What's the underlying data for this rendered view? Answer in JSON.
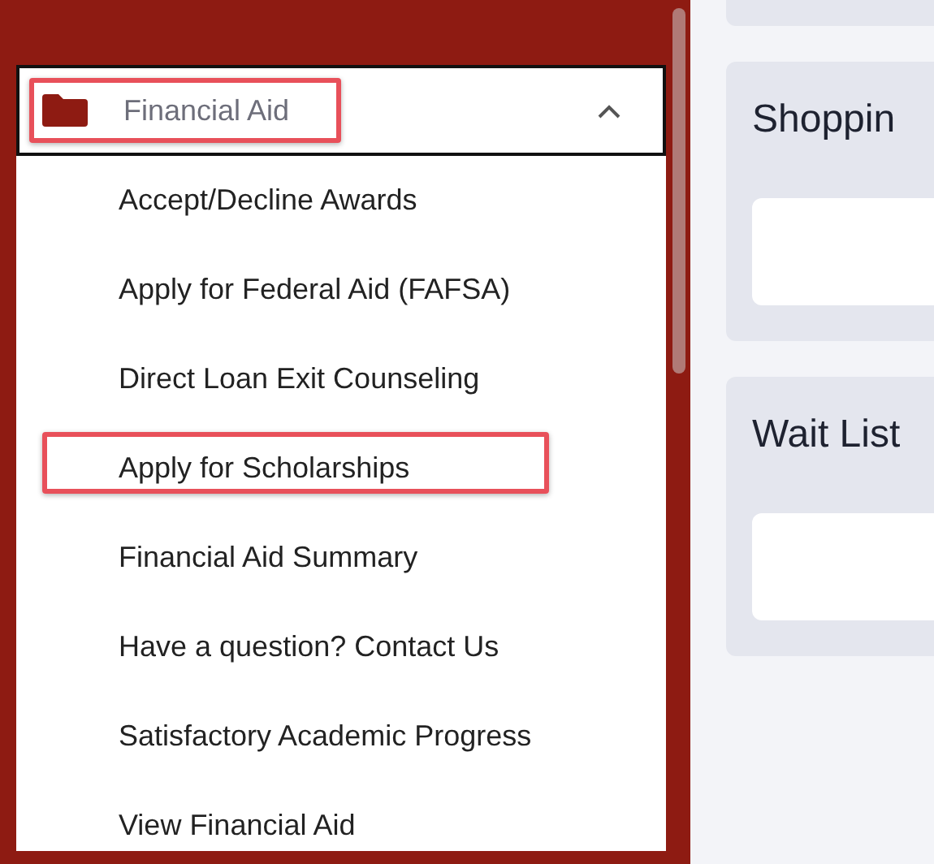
{
  "menu": {
    "title": "Financial Aid",
    "expanded": true,
    "highlighted": true,
    "items": [
      {
        "label": "Accept/Decline Awards",
        "highlighted": false
      },
      {
        "label": "Apply for Federal Aid (FAFSA)",
        "highlighted": false
      },
      {
        "label": "Direct Loan Exit Counseling",
        "highlighted": false
      },
      {
        "label": "Apply for Scholarships",
        "highlighted": true
      },
      {
        "label": "Financial Aid Summary",
        "highlighted": false
      },
      {
        "label": "Have a question? Contact Us",
        "highlighted": false
      },
      {
        "label": "Satisfactory Academic Progress",
        "highlighted": false
      },
      {
        "label": "View Financial Aid",
        "highlighted": false
      }
    ]
  },
  "cards": [
    {
      "title": "Shoppin"
    },
    {
      "title": "Wait List"
    }
  ]
}
